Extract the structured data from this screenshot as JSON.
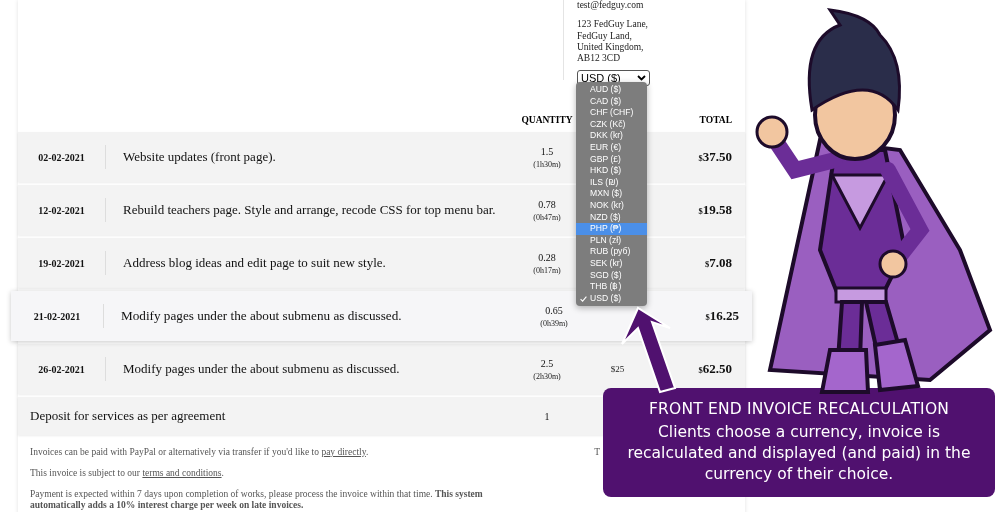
{
  "contact": {
    "email": "test@fedguy.com",
    "address_lines": [
      "123 FedGuy Lane,",
      "FedGuy Land,",
      "United Kingdom,",
      "AB12 3CD"
    ]
  },
  "currency_select": {
    "value": "USD ($)",
    "options": [
      {
        "label": "AUD ($)",
        "highlighted": false,
        "checked": false
      },
      {
        "label": "CAD ($)",
        "highlighted": false,
        "checked": false
      },
      {
        "label": "CHF (CHF)",
        "highlighted": false,
        "checked": false
      },
      {
        "label": "CZK (Kč)",
        "highlighted": false,
        "checked": false
      },
      {
        "label": "DKK (kr)",
        "highlighted": false,
        "checked": false
      },
      {
        "label": "EUR (€)",
        "highlighted": false,
        "checked": false
      },
      {
        "label": "GBP (£)",
        "highlighted": false,
        "checked": false
      },
      {
        "label": "HKD ($)",
        "highlighted": false,
        "checked": false
      },
      {
        "label": "ILS (₪)",
        "highlighted": false,
        "checked": false
      },
      {
        "label": "MXN ($)",
        "highlighted": false,
        "checked": false
      },
      {
        "label": "NOK (kr)",
        "highlighted": false,
        "checked": false
      },
      {
        "label": "NZD ($)",
        "highlighted": false,
        "checked": false
      },
      {
        "label": "PHP (₱)",
        "highlighted": true,
        "checked": false
      },
      {
        "label": "PLN (zł)",
        "highlighted": false,
        "checked": false
      },
      {
        "label": "RUB (руб)",
        "highlighted": false,
        "checked": false
      },
      {
        "label": "SEK (kr)",
        "highlighted": false,
        "checked": false
      },
      {
        "label": "SGD ($)",
        "highlighted": false,
        "checked": false
      },
      {
        "label": "THB (฿)",
        "highlighted": false,
        "checked": false
      },
      {
        "label": "USD ($)",
        "highlighted": false,
        "checked": true
      }
    ]
  },
  "table": {
    "columns": [
      {
        "label": "QUANTITY"
      },
      {
        "label": "TOTAL"
      }
    ],
    "rows": [
      {
        "kind": "item",
        "raised": false,
        "date": "02-02-2021",
        "description": "Website updates (front page).",
        "quantity": "1.5",
        "duration": "(1h30m)",
        "total_currency": "$",
        "total": "37.50"
      },
      {
        "kind": "item",
        "raised": false,
        "date": "12-02-2021",
        "description": "Rebuild teachers page. Style and arrange, recode CSS for top menu bar.",
        "quantity": "0.78",
        "duration": "(0h47m)",
        "total_currency": "$",
        "total": "19.58"
      },
      {
        "kind": "item",
        "raised": false,
        "date": "19-02-2021",
        "description": "Address blog ideas and edit page to suit new style.",
        "quantity": "0.28",
        "duration": "(0h17m)",
        "total_currency": "$",
        "total": "7.08"
      },
      {
        "kind": "item",
        "raised": true,
        "date": "21-02-2021",
        "description": "Modify pages under the about submenu as discussed.",
        "quantity": "0.65",
        "duration": "(0h39m)",
        "total_currency": "$",
        "total": "16.25"
      },
      {
        "kind": "item",
        "raised": false,
        "date": "26-02-2021",
        "description": "Modify pages under the about submenu as discussed.",
        "quantity": "2.5",
        "duration": "(2h30m)",
        "rate": "$25",
        "total_currency": "$",
        "total": "62.50"
      },
      {
        "kind": "deposit",
        "raised": false,
        "description": "Deposit for services as per agreement",
        "quantity": "1"
      }
    ]
  },
  "footer": {
    "paragraphs": [
      {
        "text": "Invoices can be paid with PayPal or alternatively via transfer if you'd like to ",
        "link": "pay directly",
        "after": "."
      },
      {
        "text": "This invoice is subject to our ",
        "link": "terms and conditions",
        "after": "."
      },
      {
        "text": "Payment is expected within 7 days upon completion of works, please process the invoice within that time. **This system automatically adds a 10% interest charge per week on late invoices.**"
      }
    ],
    "side_text": "T"
  },
  "callout": {
    "title": "FRONT END INVOICE RECALCULATION",
    "body": "Clients choose a currency, invoice is recalculated and displayed (and paid) in the currency of their choice."
  }
}
